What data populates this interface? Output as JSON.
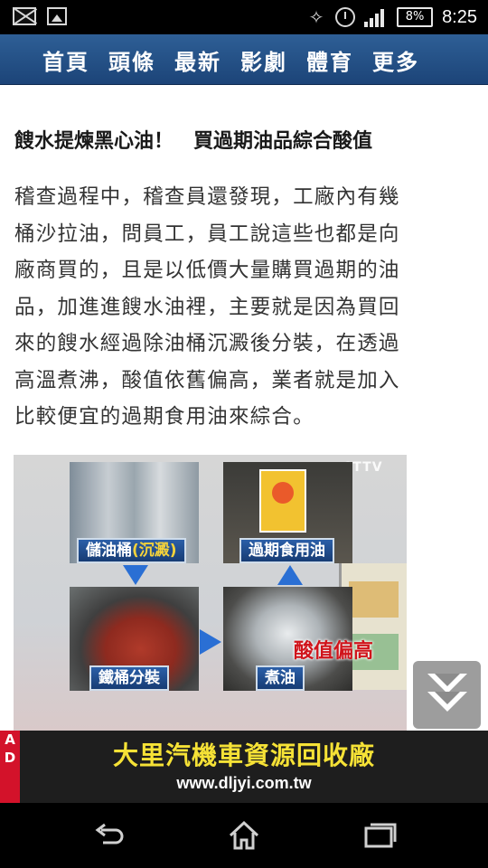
{
  "status_bar": {
    "battery_text": "8%",
    "time": "8:25",
    "left_icons": [
      "mail-icon",
      "image-icon"
    ],
    "right_icons": [
      "vibrate-icon",
      "alarm-icon",
      "signal-icon",
      "battery-icon"
    ]
  },
  "nav": {
    "items": [
      {
        "label": "首頁"
      },
      {
        "label": "頭條"
      },
      {
        "label": "最新"
      },
      {
        "label": "影劇"
      },
      {
        "label": "體育"
      },
      {
        "label": "更多"
      }
    ]
  },
  "article": {
    "subheading": "餿水提煉黑心油！　買過期油品綜合酸值",
    "paragraph_lines": [
      "稽查過程中，稽查員還發現，工廠內有幾",
      "桶沙拉油，問員工，員工說這些也都是向",
      "廠商買的，且是以低價大量購買過期的油",
      "品，加進進餿水油裡，主要就是因為買回",
      "來的餿水經過除油桶沉澱後分裝，在透過",
      "高溫煮沸，酸值依舊偏高，業者就是加入",
      "比較便宜的過期食用油來綜合。"
    ],
    "figure": {
      "watermark": "CTTV",
      "label_tank": "儲油桶",
      "label_tank_accent": "(沉澱)",
      "label_expired": "過期食用油",
      "label_drum": "鐵桶分裝",
      "label_boil": "煮油",
      "red_text": "酸值偏高"
    }
  },
  "scroll_button": {
    "icon": "double-chevron-down-icon"
  },
  "ad": {
    "tag_letters": [
      "A",
      "D"
    ],
    "title": "大里汽機車資源回收廠",
    "url": "www.dljyi.com.tw"
  },
  "system_nav": {
    "icons": [
      "back-icon",
      "home-icon",
      "recent-apps-icon"
    ]
  },
  "colors": {
    "nav_bar": "#245290",
    "ad_title": "#f6e236",
    "ad_tag": "#d3122a",
    "red_text": "#d0141b"
  }
}
